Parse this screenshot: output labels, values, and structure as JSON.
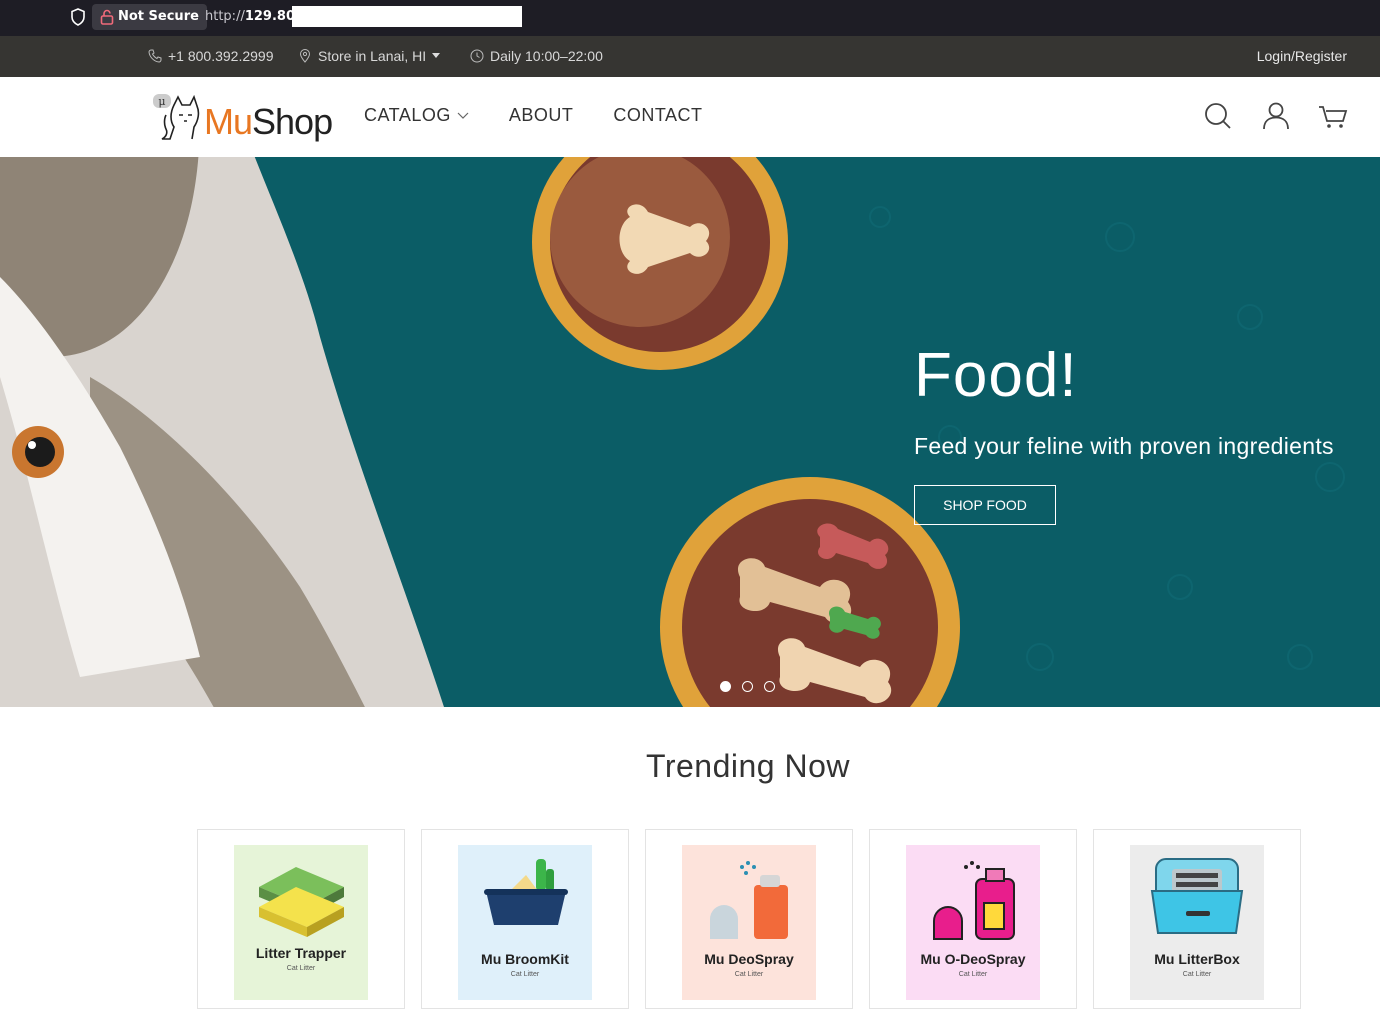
{
  "browser": {
    "security_label": "Not Secure",
    "url_prefix": "http://",
    "url_host": "129.80.1"
  },
  "info_bar": {
    "phone": "+1 800.392.2999",
    "store": "Store in Lanai, HI",
    "hours": "Daily 10:00–22:00",
    "login": "Login/Register"
  },
  "header": {
    "logo_mu": "Mu",
    "logo_shop": "Shop",
    "nav": [
      {
        "label": "CATALOG",
        "has_dropdown": true
      },
      {
        "label": "ABOUT"
      },
      {
        "label": "CONTACT"
      }
    ],
    "icons": [
      "search-icon",
      "user-icon",
      "cart-icon"
    ]
  },
  "hero": {
    "title": "Food!",
    "subtitle": "Feed your feline with proven ingredients",
    "button": "SHOP FOOD",
    "slides": 3,
    "active_slide": 1,
    "background": "#0b5d66"
  },
  "trending": {
    "title": "Trending Now",
    "products": [
      {
        "name": "Litter Trapper",
        "category": "Cat Litter",
        "bg": "#e6f4d8"
      },
      {
        "name": "Mu BroomKit",
        "category": "Cat Litter",
        "bg": "#dff0fa"
      },
      {
        "name": "Mu DeoSpray",
        "category": "Cat Litter",
        "bg": "#fde3db"
      },
      {
        "name": "Mu O-DeoSpray",
        "category": "Cat Litter",
        "bg": "#fbdcf4"
      },
      {
        "name": "Mu LitterBox",
        "category": "Cat Litter",
        "bg": "#ececec"
      }
    ]
  },
  "colors": {
    "accent": "#e87722",
    "info_bar_bg": "#363532",
    "browser_bg": "#1e1d25"
  }
}
